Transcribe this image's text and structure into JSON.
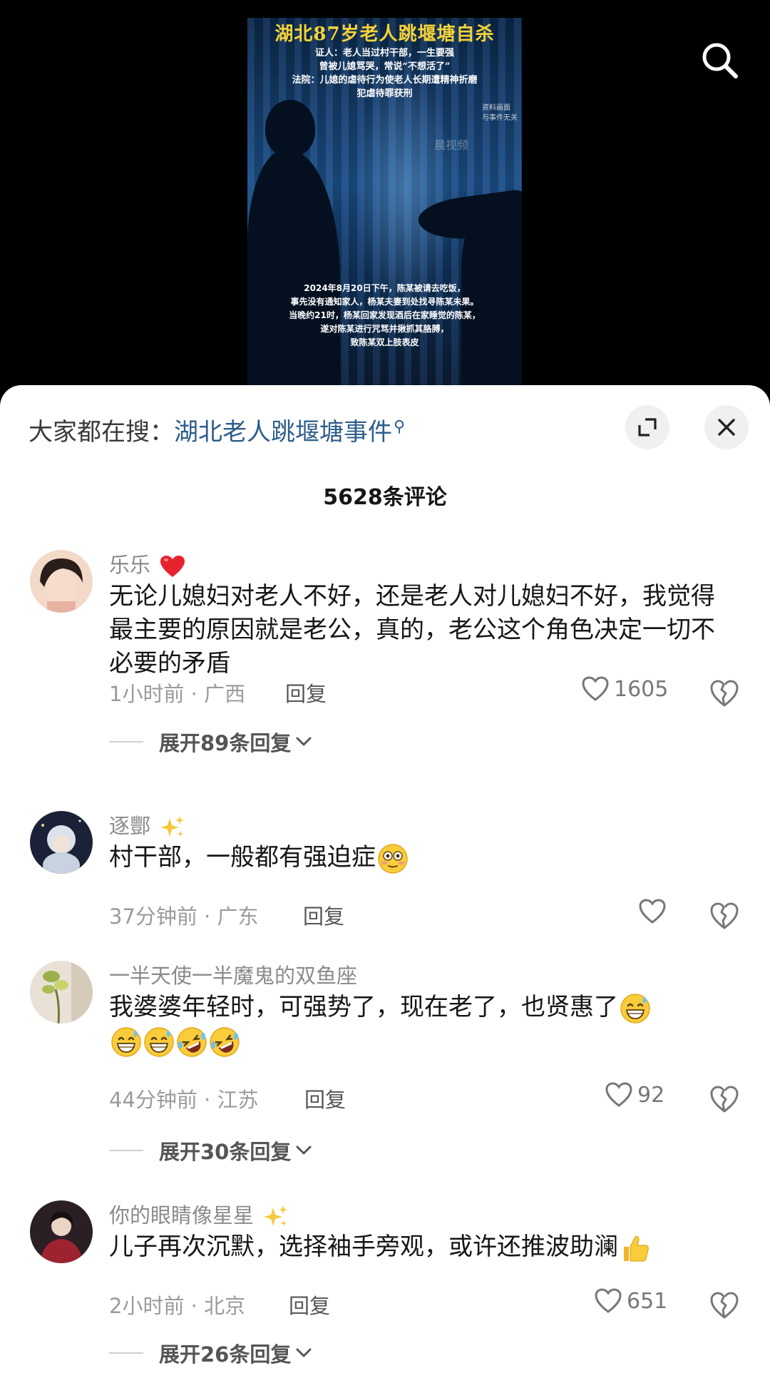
{
  "video": {
    "thumb_title": "湖北87岁老人跳堰塘自杀",
    "thumb_lines": [
      "证人：老人当过村干部，一生要强",
      "曾被儿媳骂哭，常说“不想活了”",
      "法院：儿媳的虐待行为使老人长期遭精神折磨",
      "犯虐待罪获刑"
    ],
    "thumb_note": [
      "资料画面",
      "与事件无关"
    ],
    "thumb_watermark": "晨视频",
    "thumb_body": [
      "2024年8月20日下午，陈某被请去吃饭，",
      "事先没有通知家人，杨某夫妻到处找寻陈某未果。",
      "当晚约21时，杨某回家发现酒后在家睡觉的陈某，",
      "遂对陈某进行咒骂并揪抓其胳膊，",
      "致陈某双上肢表皮"
    ]
  },
  "search_hint": {
    "prefix": "大家都在搜：",
    "keyword": "湖北老人跳堰塘事件"
  },
  "comments_count_title": "5628条评论",
  "comments": [
    {
      "username": "乐乐",
      "username_emoji": "red-heart",
      "text": "无论儿媳妇对老人不好，还是老人对儿媳妇不好，我觉得最主要的原因就是老公，真的，老公这个角色决定一切不必要的矛盾",
      "meta": "1小时前 · 广西",
      "reply_label": "回复",
      "likes": "1605",
      "expand": "展开89条回复"
    },
    {
      "username": "逐酆",
      "username_emoji": "sparkles",
      "text": "村干部，一般都有强迫症",
      "text_emoji": "flushed-face",
      "meta": "37分钟前 · 广东",
      "reply_label": "回复",
      "likes": ""
    },
    {
      "username": "一半天使一半魔鬼的双鱼座",
      "text": "我婆婆年轻时，可强势了，现在老了，也贤惠了",
      "meta": "44分钟前 · 江苏",
      "reply_label": "回复",
      "likes": "92",
      "expand": "展开30条回复"
    },
    {
      "username": "你的眼睛像星星",
      "username_emoji": "sparkles",
      "text": "儿子再次沉默，选择袖手旁观，或许还推波助澜",
      "text_emoji": "thumbs-up",
      "meta": "2小时前 · 北京",
      "reply_label": "回复",
      "likes": "651",
      "expand": "展开26条回复"
    }
  ]
}
